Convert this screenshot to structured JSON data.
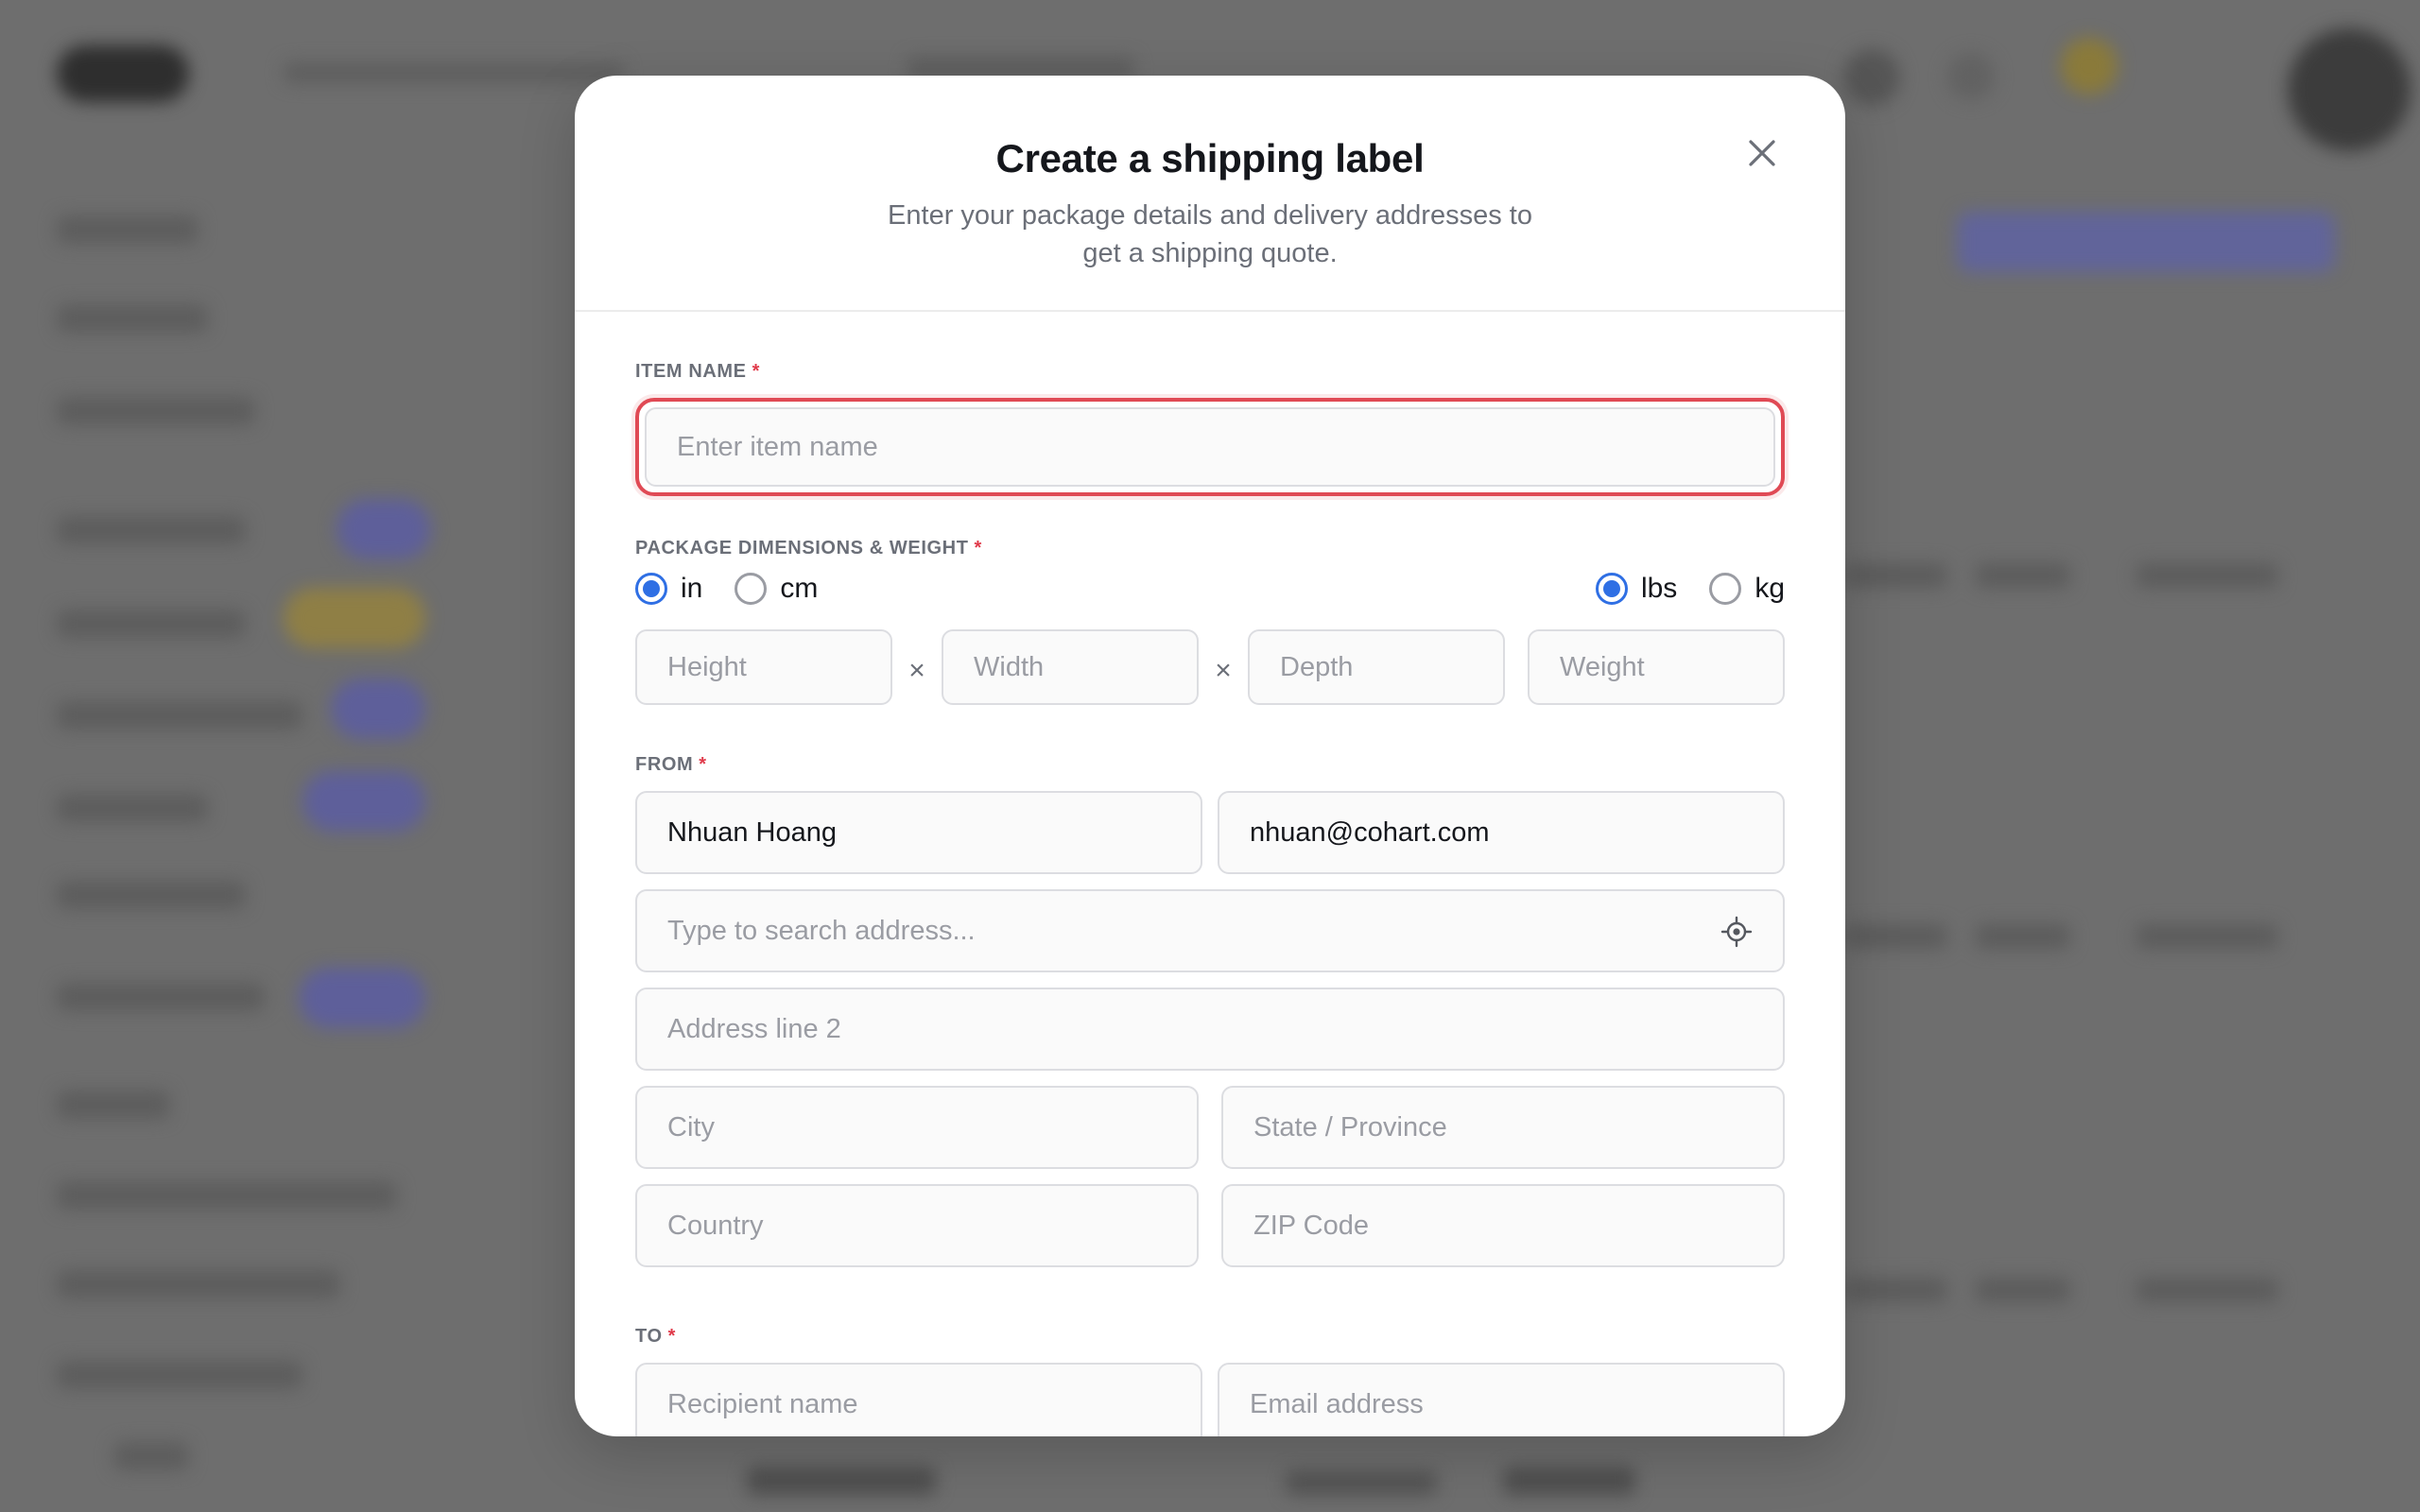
{
  "modal": {
    "title": "Create a shipping label",
    "subtitle": "Enter your package details and delivery addresses to get a shipping quote.",
    "close_icon": "close-icon"
  },
  "item": {
    "label": "ITEM NAME",
    "required_mark": "*",
    "placeholder": "Enter item name",
    "state": "error"
  },
  "dimensions": {
    "label": "PACKAGE DIMENSIONS & WEIGHT",
    "required_mark": "*",
    "length_units": [
      {
        "label": "in",
        "selected": true
      },
      {
        "label": "cm",
        "selected": false
      }
    ],
    "weight_units": [
      {
        "label": "lbs",
        "selected": true
      },
      {
        "label": "kg",
        "selected": false
      }
    ],
    "height_placeholder": "Height",
    "width_placeholder": "Width",
    "depth_placeholder": "Depth",
    "weight_placeholder": "Weight",
    "times_symbol": "×"
  },
  "from": {
    "label": "FROM",
    "required_mark": "*",
    "name_value": "Nhuan Hoang",
    "email_value": "nhuan@cohart.com",
    "address_placeholder": "Type to search address...",
    "locate_icon": "locate-icon",
    "address2_placeholder": "Address line 2",
    "city_placeholder": "City",
    "state_placeholder": "State / Province",
    "country_placeholder": "Country",
    "zip_placeholder": "ZIP Code"
  },
  "to": {
    "label": "TO",
    "required_mark": "*",
    "name_placeholder": "Recipient name",
    "email_placeholder": "Email address"
  },
  "colors": {
    "accent": "#2f6fe4",
    "error": "#e04a55",
    "overlay": "#6e6e6e"
  }
}
